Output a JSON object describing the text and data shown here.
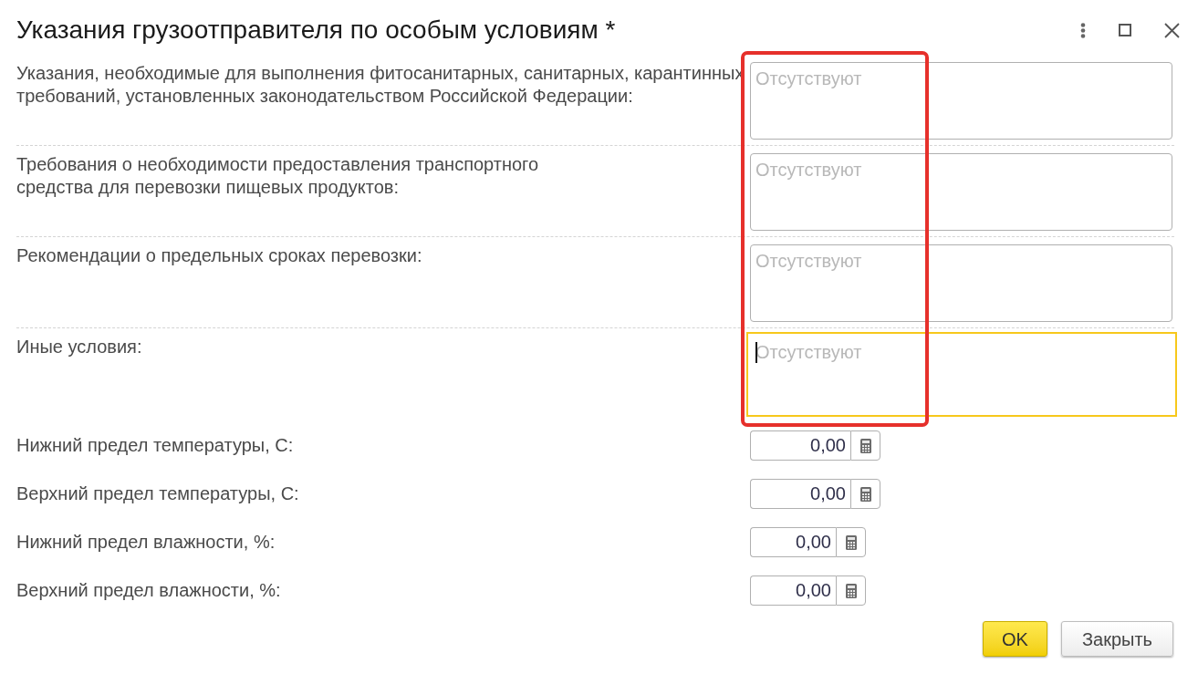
{
  "window": {
    "title": "Указания грузоотправителя по особым условиям *"
  },
  "text_fields": [
    {
      "label_lines": [
        "Указания, необходимые для выполнения фитосанитарных, санитарных, карантинных",
        "требований, установленных законодательством Российской Федерации:"
      ],
      "placeholder": "Отсутствуют",
      "focused": false
    },
    {
      "label_lines": [
        "Требования о необходимости предоставления транспортного",
        "средства для перевозки пищевых продуктов:"
      ],
      "placeholder": "Отсутствуют",
      "focused": false
    },
    {
      "label_lines": [
        "Рекомендации о предельных сроках перевозки:"
      ],
      "placeholder": "Отсутствуют",
      "focused": false
    },
    {
      "label_lines": [
        "Иные условия:"
      ],
      "placeholder": "Отсутствуют",
      "focused": true
    }
  ],
  "number_fields": [
    {
      "label": "Нижний предел температуры, С:",
      "value": "0,00"
    },
    {
      "label": "Верхний предел температуры, С:",
      "value": "0,00"
    },
    {
      "label": "Нижний предел влажности, %:",
      "value": "0,00"
    },
    {
      "label": "Верхний предел влажности, %:",
      "value": "0,00"
    }
  ],
  "buttons": [
    {
      "label": "OK",
      "default": true
    },
    {
      "label": "Закрыть",
      "default": false
    }
  ],
  "highlight_frame": true
}
